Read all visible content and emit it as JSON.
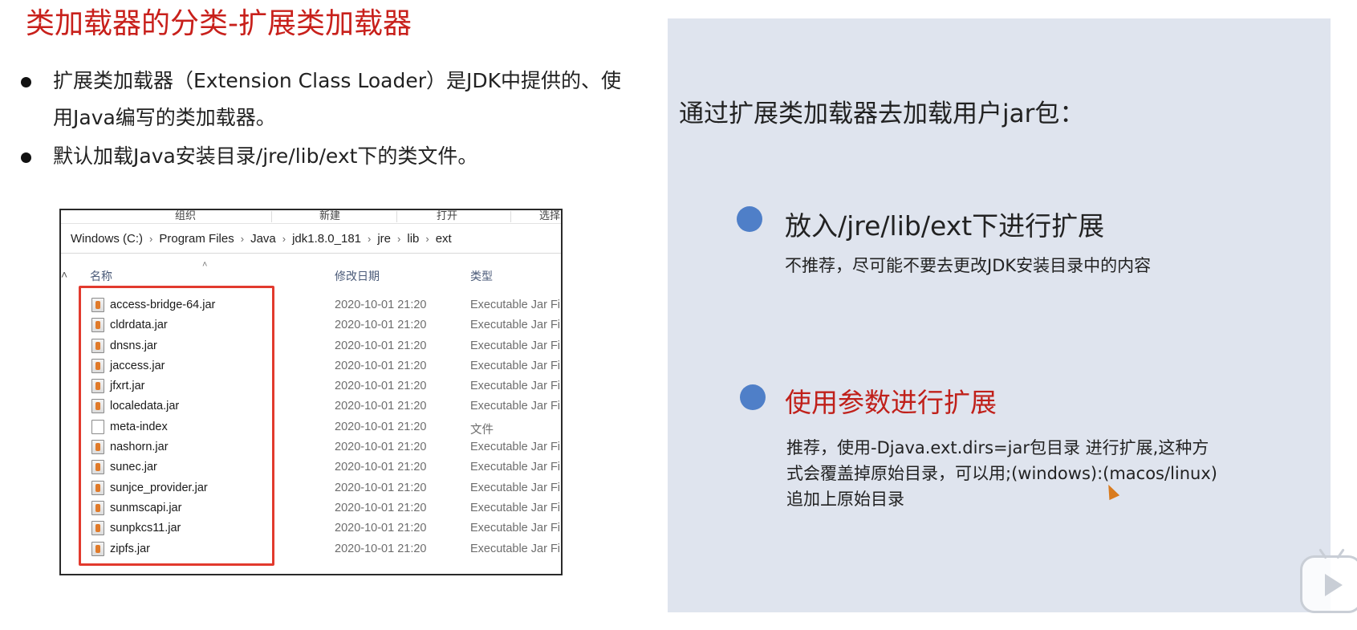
{
  "slide": {
    "title": "类加载器的分类-扩展类加载器",
    "bullets": [
      "扩展类加载器（Extension Class Loader）是JDK中提供的、使用Java编写的类加载器。",
      "默认加载Java安装目录/jre/lib/ext下的类文件。"
    ]
  },
  "explorer": {
    "ribbon": [
      "组织",
      "新建",
      "打开",
      "选择"
    ],
    "breadcrumb": [
      "Windows (C:)",
      "Program Files",
      "Java",
      "jdk1.8.0_181",
      "jre",
      "lib",
      "ext"
    ],
    "columns": {
      "name": "名称",
      "date": "修改日期",
      "type": "类型"
    },
    "files": [
      {
        "name": "access-bridge-64.jar",
        "date": "2020-10-01 21:20",
        "type": "Executable Jar Fi",
        "icon": "jar-file-icon"
      },
      {
        "name": "cldrdata.jar",
        "date": "2020-10-01 21:20",
        "type": "Executable Jar Fi",
        "icon": "jar-file-icon"
      },
      {
        "name": "dnsns.jar",
        "date": "2020-10-01 21:20",
        "type": "Executable Jar Fi",
        "icon": "jar-file-icon"
      },
      {
        "name": "jaccess.jar",
        "date": "2020-10-01 21:20",
        "type": "Executable Jar Fi",
        "icon": "jar-file-icon"
      },
      {
        "name": "jfxrt.jar",
        "date": "2020-10-01 21:20",
        "type": "Executable Jar Fi",
        "icon": "jar-file-icon"
      },
      {
        "name": "localedata.jar",
        "date": "2020-10-01 21:20",
        "type": "Executable Jar Fi",
        "icon": "jar-file-icon"
      },
      {
        "name": "meta-index",
        "date": "2020-10-01 21:20",
        "type": "文件",
        "icon": "file-icon"
      },
      {
        "name": "nashorn.jar",
        "date": "2020-10-01 21:20",
        "type": "Executable Jar Fi",
        "icon": "jar-file-icon"
      },
      {
        "name": "sunec.jar",
        "date": "2020-10-01 21:20",
        "type": "Executable Jar Fi",
        "icon": "jar-file-icon"
      },
      {
        "name": "sunjce_provider.jar",
        "date": "2020-10-01 21:20",
        "type": "Executable Jar Fi",
        "icon": "jar-file-icon"
      },
      {
        "name": "sunmscapi.jar",
        "date": "2020-10-01 21:20",
        "type": "Executable Jar Fi",
        "icon": "jar-file-icon"
      },
      {
        "name": "sunpkcs11.jar",
        "date": "2020-10-01 21:20",
        "type": "Executable Jar Fi",
        "icon": "jar-file-icon"
      },
      {
        "name": "zipfs.jar",
        "date": "2020-10-01 21:20",
        "type": "Executable Jar Fi",
        "icon": "jar-file-icon"
      }
    ]
  },
  "panel": {
    "heading": "通过扩展类加载器去加载用户jar包：",
    "option1": {
      "title": "放入/jre/lib/ext下进行扩展",
      "desc": "不推荐，尽可能不要去更改JDK安装目录中的内容"
    },
    "option2": {
      "title": "使用参数进行扩展",
      "desc_lines": [
        "推荐，使用-Djava.ext.dirs=jar包目录 进行扩展,这种方",
        "式会覆盖掉原始目录，可以用;(windows):(macos/linux)",
        "追加上原始目录"
      ]
    }
  },
  "colors": {
    "title_red": "#c8201b",
    "option2_red": "#c0201a",
    "panel_bg": "#dfe4ee",
    "dot_blue": "#4f7fc8",
    "highlight_red": "#e23a2e"
  }
}
